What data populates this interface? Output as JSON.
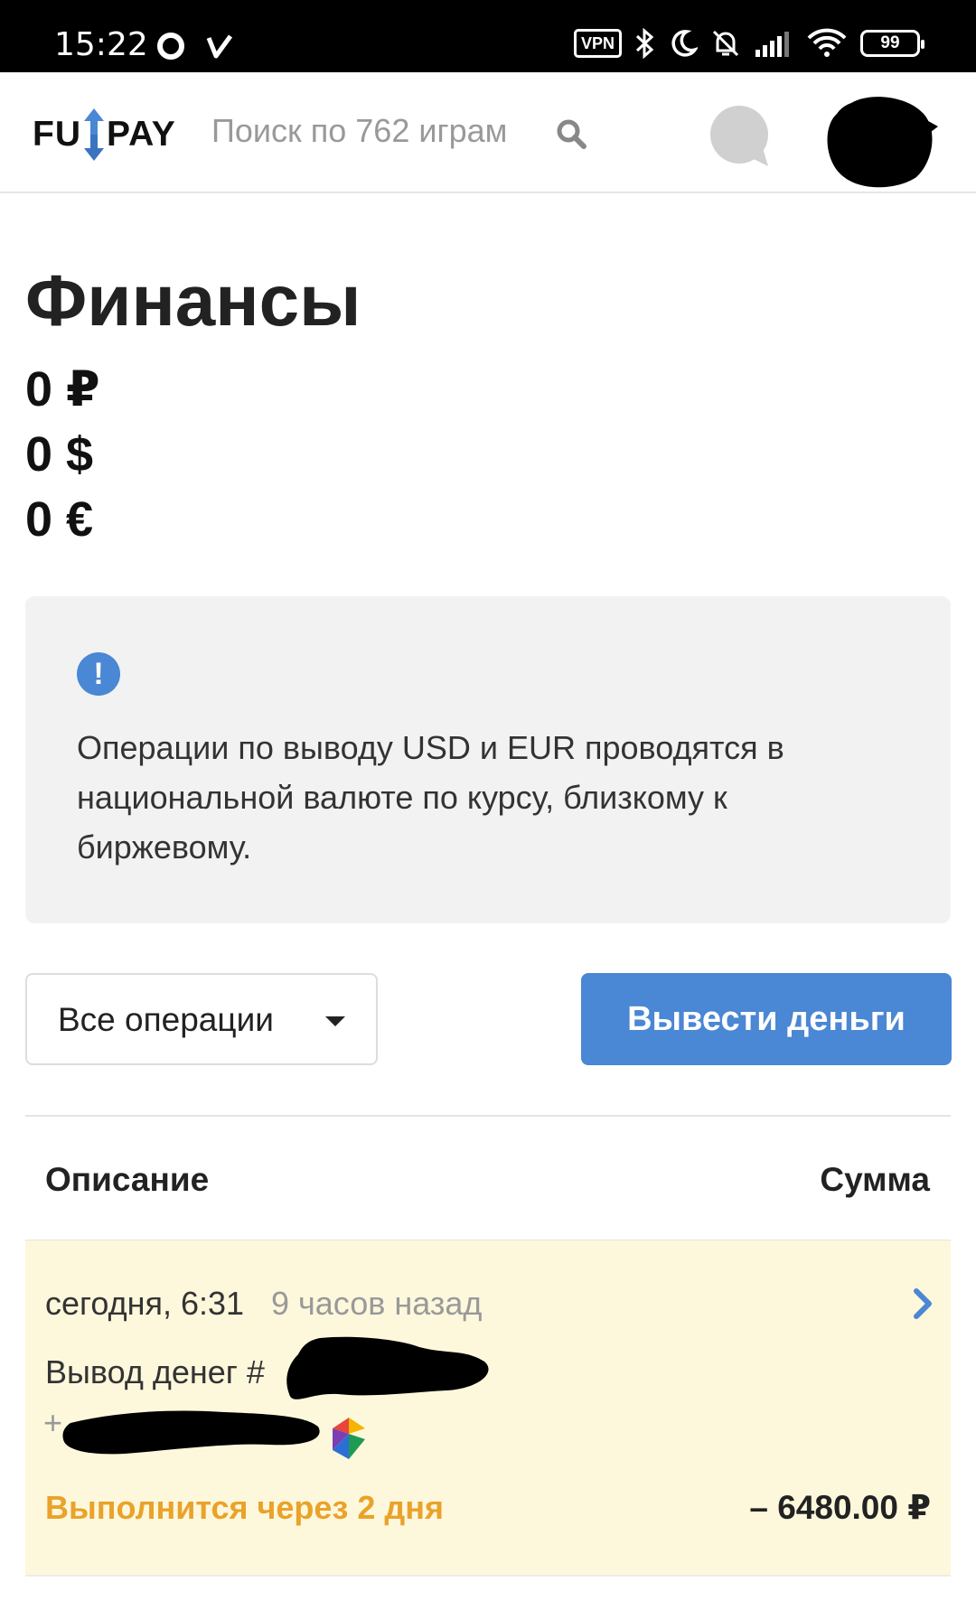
{
  "status_bar": {
    "time": "15:22",
    "vpn": "VPN",
    "battery": "99"
  },
  "header": {
    "logo_left": "FU",
    "logo_right": "PAY",
    "search_placeholder": "Поиск по 762 играм"
  },
  "page": {
    "title": "Финансы",
    "balances": [
      "0 ₽",
      "0 $",
      "0 €"
    ],
    "notice_text": "Операции по выводу USD и EUR проводятся в национальной валюте по курсу, близкому к биржевому.",
    "filter_selected": "Все операции",
    "withdraw_label": "Вывести деньги"
  },
  "table": {
    "col_description": "Описание",
    "col_amount": "Сумма",
    "rows": [
      {
        "date": "сегодня, 6:31",
        "ago": "9 часов назад",
        "description": "Вывод денег #",
        "account_prefix": "+",
        "status": "Выполнится через 2 дня",
        "amount": "– 6480.00 ₽"
      }
    ]
  },
  "colors": {
    "accent": "#4a87d4",
    "pending": "#eaa22a",
    "row_bg": "#fdf8dc"
  }
}
